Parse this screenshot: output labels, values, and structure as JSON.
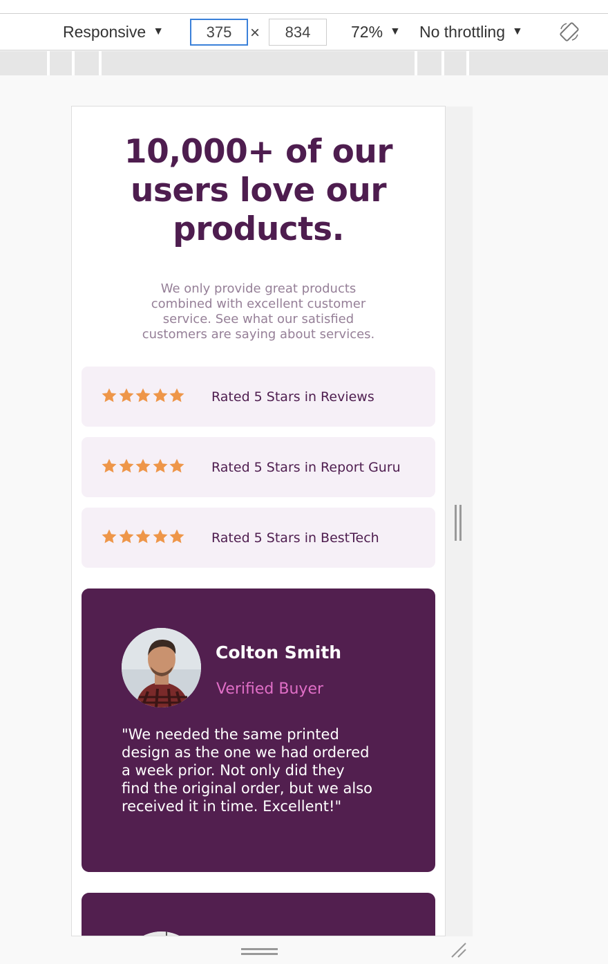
{
  "devtools": {
    "device_label": "Responsive",
    "width_value": "375",
    "height_value": "834",
    "times": "×",
    "zoom_label": "72%",
    "throttle_label": "No throttling",
    "caret": "▼"
  },
  "page": {
    "heading_lines": [
      "10,000+ of our",
      "users love our",
      "products."
    ],
    "subtext_lines": [
      "We only provide great products",
      "combined with excellent customer",
      "service. See what our satisfied",
      "customers are saying about services."
    ],
    "ratings": [
      {
        "label": "Rated 5 Stars in Reviews",
        "stars": 5
      },
      {
        "label": "Rated 5 Stars in Report Guru",
        "stars": 5
      },
      {
        "label": "Rated 5 Stars in BestTech",
        "stars": 5
      }
    ],
    "testimonial": {
      "name": "Colton Smith",
      "status": "Verified Buyer",
      "quote_lines": [
        "\"We needed the same printed",
        "design as the one we had ordered",
        "a week prior. Not only did they",
        "find the original order, but we also",
        "received it in time. Excellent!\""
      ]
    }
  },
  "colors": {
    "heading": "#4e1d4f",
    "subtext": "#957f97",
    "rating_bg": "#f6f0f7",
    "star": "#ee9649",
    "card_bg": "#521f4f",
    "verified": "#e06fc7",
    "devtools_focus": "#3a80d9"
  },
  "icons": {
    "star": "star-icon",
    "rotate": "rotate-device-icon",
    "avatar": "reviewer-avatar"
  }
}
